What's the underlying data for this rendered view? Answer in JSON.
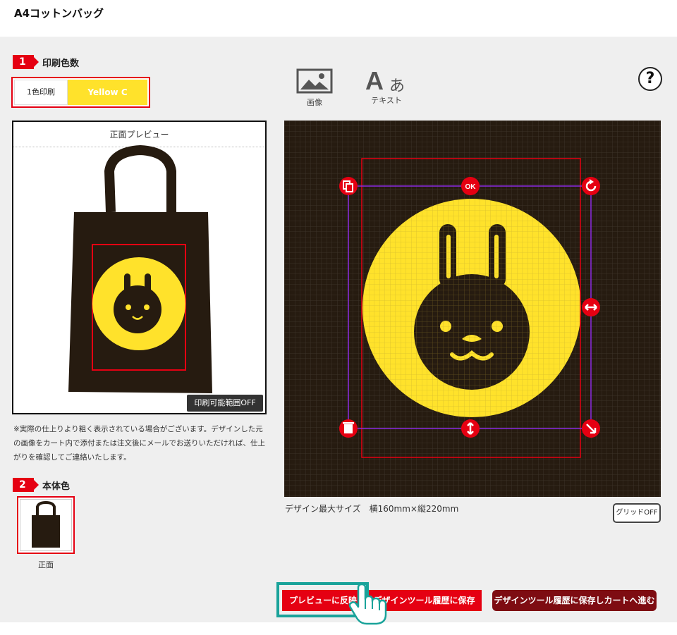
{
  "header": {
    "title": "A4コットンバッグ"
  },
  "step1": {
    "number": "1",
    "title": "印刷色数",
    "count_label": "1色印刷",
    "color_label": "Yellow C"
  },
  "preview": {
    "title": "正面プレビュー",
    "range_button": "印刷可能範囲OFF"
  },
  "note": {
    "text": "※実際の仕上りより粗く表示されている場合がございます。デザインした元の画像をカート内で添付または注文後にメールでお送りいただければ、仕上がりを確認してご連絡いたします。"
  },
  "step2": {
    "number": "2",
    "title": "本体色",
    "body_label": "正面"
  },
  "tools": {
    "image_label": "画像",
    "text_label": "テキスト",
    "text_glyph_a": "A",
    "text_glyph_kana": "あ",
    "help": "?"
  },
  "canvas": {
    "ok_label": "OK",
    "grid_button": "グリッドOFF",
    "max_size": "デザイン最大サイズ　横160mm×縦220mm"
  },
  "buttons": {
    "preview": "プレビューに反映",
    "save": "デザインツール履歴に保存",
    "cart": "デザインツール履歴に保存しカートへ進む"
  },
  "colors": {
    "accent": "#e50012",
    "ink": "#ffe22b",
    "bag": "#261b10",
    "dark_button": "#7e0c12",
    "highlight": "#1aa39a"
  }
}
